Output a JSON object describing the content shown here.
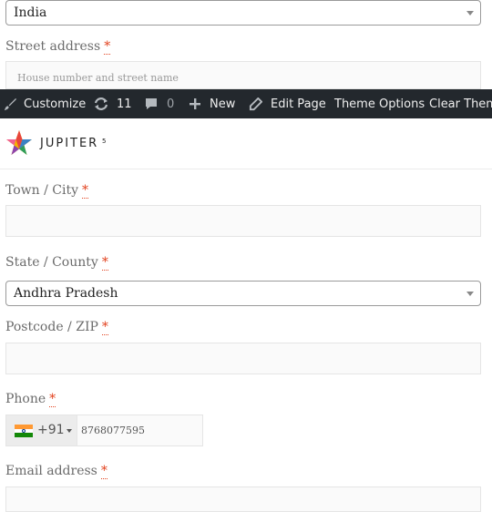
{
  "country": {
    "value": "India"
  },
  "street": {
    "label": "Street address",
    "required": "*",
    "placeholder": "House number and street name"
  },
  "adminbar": {
    "customize": "Customize",
    "updates_count": "11",
    "comments_count": "0",
    "new": "New",
    "edit_page": "Edit Page",
    "theme_options": "Theme Options",
    "clear_theme": "Clear Theme"
  },
  "logo": {
    "text": "JUPITER",
    "superscript": "5"
  },
  "town": {
    "label": "Town / City",
    "required": "*"
  },
  "state": {
    "label": "State / County",
    "required": "*",
    "value": "Andhra Pradesh"
  },
  "postcode": {
    "label": "Postcode / ZIP",
    "required": "*"
  },
  "phone": {
    "label": "Phone",
    "required": "*",
    "dial_code": "+91",
    "value": "8768077595"
  },
  "email": {
    "label": "Email address",
    "required": "*"
  },
  "colors": {
    "required": "#e2401c",
    "adminbar_bg": "#23282d"
  }
}
